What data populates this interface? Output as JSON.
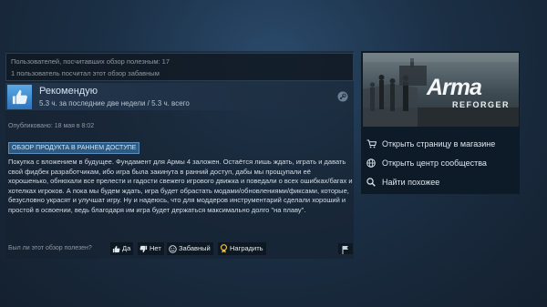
{
  "helpful": {
    "line1": "Пользователей, посчитавших обзор полезным: 17",
    "line2": "1 пользователь посчитал этот обзор забавным"
  },
  "verdict": {
    "title": "Рекомендую",
    "hours": "5.3 ч. за последние две недели / 5.3 ч. всего"
  },
  "posted": "Опубликовано: 18 мая в 8:02",
  "early_access_badge": "ОБЗОР ПРОДУКТА В РАННЕМ ДОСТУПЕ",
  "review_text": "Покупка с вложением в будущее. Фундамент для Армы 4 заложен. Остаётся лишь ждать, играть и давать свой фидбек разработчикам, ибо игра была закинута в ранний доступ, дабы мы прощупали её хорошенько, обнюхали все прелести и гадости свежего игрового движка и поведали о всех ошибках/багах и хотелках игроков. А пока мы будем ждать, игра будет обрастать модами/обновлениями/фиксами, которые, безусловно украсят и улучшат игру. Ну и надеюсь, что для моддеров инструментарий сделали хороший и простой в освоении, ведь благодаря им игра будет держаться максимально долго \"на плаву\".",
  "vote": {
    "label": "Был ли этот обзор полезен?",
    "yes": "Да",
    "no": "Нет",
    "funny": "Забавный",
    "award": "Наградить"
  },
  "game": {
    "logo": "Arma",
    "subtitle": "REFORGER"
  },
  "side_links": {
    "store": "Открыть страницу в магазине",
    "community": "Открыть центр сообщества",
    "similar": "Найти похожее"
  },
  "colors": {
    "accent": "#66c0f4",
    "thumb": "#4a9bdc",
    "badge_bg": "#2e5a82"
  },
  "icons": [
    "thumbs-up-icon",
    "steam-icon",
    "thumbs-down-icon",
    "funny-face-icon",
    "award-icon",
    "flag-icon",
    "cart-icon",
    "globe-icon",
    "search-icon"
  ]
}
